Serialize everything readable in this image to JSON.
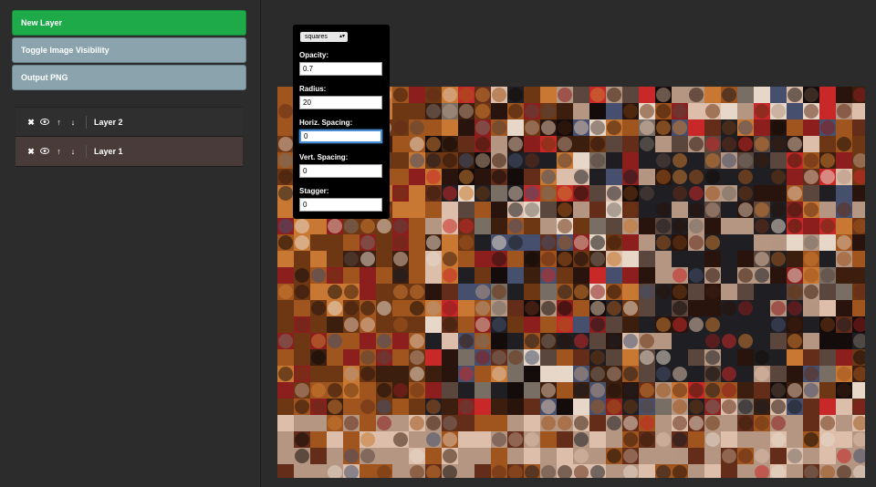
{
  "sidebar": {
    "new_layer": "New Layer",
    "toggle_visibility": "Toggle Image Visibility",
    "output_png": "Output PNG"
  },
  "layers": [
    {
      "name": "Layer 2",
      "selected": false
    },
    {
      "name": "Layer 1",
      "selected": true
    }
  ],
  "layer_icons": {
    "delete": "✖",
    "visibility": "👁",
    "move_up": "↑",
    "move_down": "↓"
  },
  "panel": {
    "shape_select": "squares",
    "opacity_label": "Opacity:",
    "opacity_value": "0.7",
    "radius_label": "Radius:",
    "radius_value": "20",
    "hspacing_label": "Horiz. Spacing:",
    "hspacing_value": "0",
    "vspacing_label": "Vert. Spacing:",
    "vspacing_value": "0",
    "stagger_label": "Stagger:",
    "stagger_value": "0"
  },
  "colors": {
    "accent_green": "#1faa4a",
    "button_grey": "#8aa3ad",
    "selected_layer": "#4a3b3b",
    "focus_blue": "#4a8fd6"
  }
}
